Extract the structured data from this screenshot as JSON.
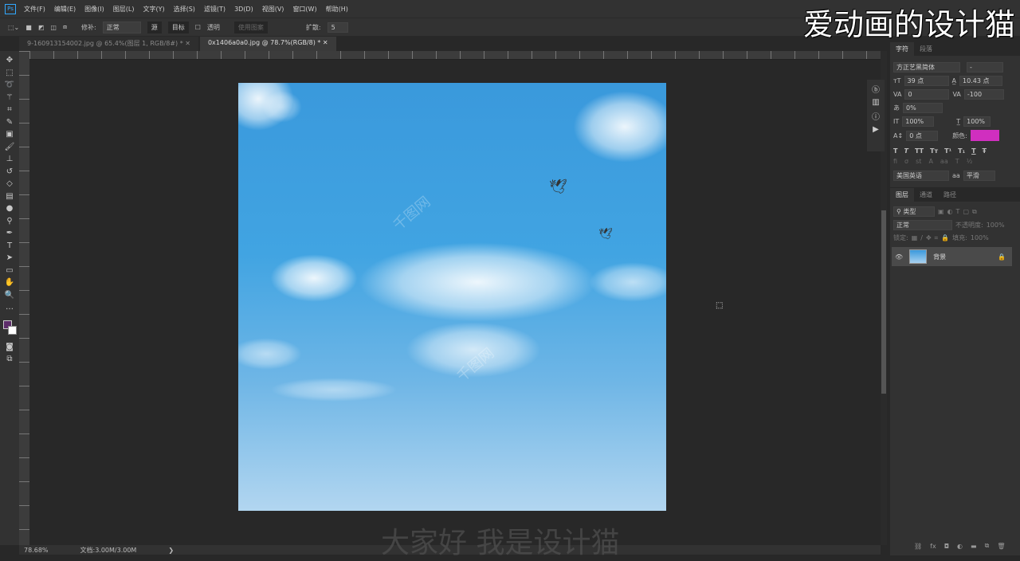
{
  "app_icon": "Ps",
  "menu": [
    "文件(F)",
    "编辑(E)",
    "图像(I)",
    "图层(L)",
    "文字(Y)",
    "选择(S)",
    "滤镜(T)",
    "3D(D)",
    "视图(V)",
    "窗口(W)",
    "帮助(H)"
  ],
  "options": {
    "patch_label": "修补:",
    "patch_mode": "正常",
    "source": "源",
    "target": "目标",
    "transparent": "透明",
    "use_pattern": "使用图案",
    "diffusion_label": "扩散:",
    "diffusion_value": "5"
  },
  "tabs": [
    {
      "label": "9-160913154002.jpg @ 65.4%(图层 1, RGB/8#) *",
      "active": false
    },
    {
      "label": "0x1406a0a0.jpg @ 78.7%(RGB/8) *",
      "active": true
    }
  ],
  "canvas": {
    "watermark": "千图网",
    "sky_color": "#3a99dc"
  },
  "status": {
    "zoom": "78.68%",
    "doc": "文档:3.00M/3.00M"
  },
  "character_panel": {
    "tabs": [
      "字符",
      "段落"
    ],
    "font_family": "方正艺黑简体",
    "font_style": "-",
    "size": "39 点",
    "leading": "10.43 点",
    "kerning": "0",
    "tracking": "-100",
    "scale_pct": "0%",
    "vertical_scale": "100%",
    "horizontal_scale": "100%",
    "baseline": "0 点",
    "color_label": "颜色:",
    "color": "#d02fbf",
    "style_buttons": [
      "T",
      "T",
      "TT",
      "Tт",
      "T¹",
      "T₁",
      "T",
      "Ŧ"
    ],
    "language": "美国英语",
    "aa_icon": "aa",
    "antialias": "平滑"
  },
  "layers_panel": {
    "tabs": [
      "图层",
      "通道",
      "路径"
    ],
    "filter_kind": "类型",
    "blend_mode": "正常",
    "opacity_label": "不透明度:",
    "opacity": "100%",
    "lock_label": "锁定:",
    "fill_label": "填充:",
    "fill": "100%",
    "layers": [
      {
        "name": "背景",
        "visible": true,
        "locked": true
      }
    ]
  },
  "overlay": {
    "channel_watermark": "爱动画的设计猫",
    "subtitle": "大家好 我是设计猫"
  }
}
